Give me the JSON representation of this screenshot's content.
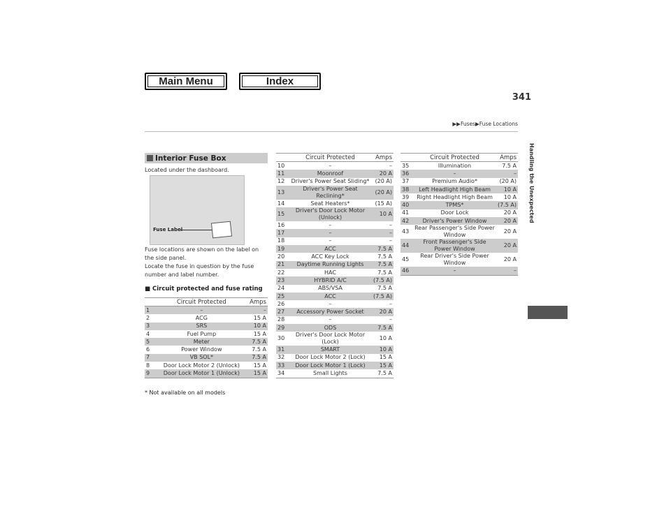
{
  "nav": {
    "main_menu": "Main Menu",
    "index": "Index"
  },
  "page_number": "341",
  "breadcrumb": "▶▶Fuses▶Fuse Locations",
  "side_tab": "Handling the Unexpected",
  "section_title": "Interior Fuse Box",
  "located": "Located under the dashboard.",
  "figure_label": "Fuse Label",
  "desc1": "Fuse locations are shown on the label on the side panel.",
  "desc2": "Locate the fuse in question by the fuse number and label number.",
  "subheading": "Circuit protected and fuse rating",
  "headers": {
    "circuit": "Circuit Protected",
    "amps": "Amps"
  },
  "tables": [
    [
      [
        "1",
        "–",
        "–"
      ],
      [
        "2",
        "ACG",
        "15 A"
      ],
      [
        "3",
        "SRS",
        "10 A"
      ],
      [
        "4",
        "Fuel Pump",
        "15 A"
      ],
      [
        "5",
        "Meter",
        "7.5 A"
      ],
      [
        "6",
        "Power Window",
        "7.5 A"
      ],
      [
        "7",
        "VB SOL*",
        "7.5 A"
      ],
      [
        "8",
        "Door Lock Motor 2 (Unlock)",
        "15 A"
      ],
      [
        "9",
        "Door Lock Motor 1 (Unlock)",
        "15 A"
      ]
    ],
    [
      [
        "10",
        "–",
        "–"
      ],
      [
        "11",
        "Moonroof",
        "20 A"
      ],
      [
        "12",
        "Driver's Power Seat Sliding*",
        "(20 A)"
      ],
      [
        "13",
        "Driver's Power Seat Reclining*",
        "(20 A)"
      ],
      [
        "14",
        "Seat Heaters*",
        "(15 A)"
      ],
      [
        "15",
        "Driver's Door Lock Motor (Unlock)",
        "10 A"
      ],
      [
        "16",
        "–",
        "–"
      ],
      [
        "17",
        "–",
        "–"
      ],
      [
        "18",
        "–",
        "–"
      ],
      [
        "19",
        "ACC",
        "7.5 A"
      ],
      [
        "20",
        "ACC Key Lock",
        "7.5 A"
      ],
      [
        "21",
        "Daytime Running Lights",
        "7.5 A"
      ],
      [
        "22",
        "HAC",
        "7.5 A"
      ],
      [
        "23",
        "HYBRID A/C",
        "(7.5 A)"
      ],
      [
        "24",
        "ABS/VSA",
        "7.5 A"
      ],
      [
        "25",
        "ACC",
        "(7.5 A)"
      ],
      [
        "26",
        "–",
        "–"
      ],
      [
        "27",
        "Accessory Power Socket",
        "20 A"
      ],
      [
        "28",
        "–",
        "–"
      ],
      [
        "29",
        "ODS",
        "7.5 A"
      ],
      [
        "30",
        "Driver's Door Lock Motor (Lock)",
        "10 A"
      ],
      [
        "31",
        "SMART",
        "10 A"
      ],
      [
        "32",
        "Door Lock Motor 2 (Lock)",
        "15 A"
      ],
      [
        "33",
        "Door Lock Motor 1 (Lock)",
        "15 A"
      ],
      [
        "34",
        "Small Lights",
        "7.5 A"
      ]
    ],
    [
      [
        "35",
        "Illumination",
        "7.5 A"
      ],
      [
        "36",
        "–",
        "–"
      ],
      [
        "37",
        "Premium Audio*",
        "(20 A)"
      ],
      [
        "38",
        "Left Headlight High Beam",
        "10 A"
      ],
      [
        "39",
        "Right Headlight High Beam",
        "10 A"
      ],
      [
        "40",
        "TPMS*",
        "(7.5 A)"
      ],
      [
        "41",
        "Door Lock",
        "20 A"
      ],
      [
        "42",
        "Driver's Power Window",
        "20 A"
      ],
      [
        "43",
        "Rear Passenger's Side Power Window",
        "20 A"
      ],
      [
        "44",
        "Front Passenger's Side Power Window",
        "20 A"
      ],
      [
        "45",
        "Rear Driver's Side Power Window",
        "20 A"
      ],
      [
        "46",
        "–",
        "–"
      ]
    ]
  ],
  "footnote": "* Not available on all models"
}
